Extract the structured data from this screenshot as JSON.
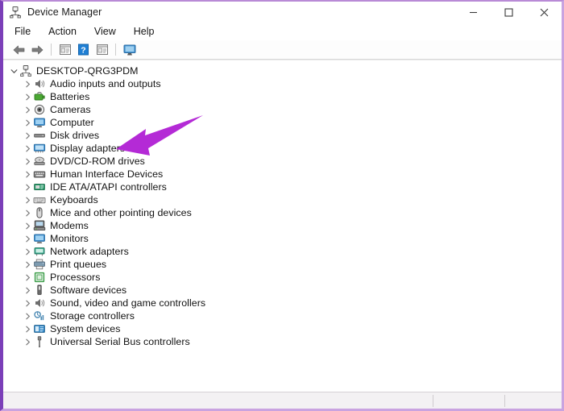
{
  "window": {
    "title": "Device Manager",
    "icon": "device-manager-icon",
    "border_color": "#7b3fb8",
    "controls": [
      {
        "name": "minimize-button",
        "glyph": "minimize"
      },
      {
        "name": "maximize-button",
        "glyph": "maximize"
      },
      {
        "name": "close-button",
        "glyph": "close"
      }
    ]
  },
  "menubar": {
    "items": [
      {
        "label": "File"
      },
      {
        "label": "Action"
      },
      {
        "label": "View"
      },
      {
        "label": "Help"
      }
    ]
  },
  "toolbar": {
    "buttons": [
      {
        "name": "back-button",
        "icon": "back-arrow-icon"
      },
      {
        "name": "forward-button",
        "icon": "forward-arrow-icon"
      },
      {
        "name": "properties-button",
        "icon": "properties-icon"
      },
      {
        "name": "help-button",
        "icon": "help-question-icon"
      },
      {
        "name": "update-driver-button",
        "icon": "update-driver-icon"
      },
      {
        "name": "scan-hardware-button",
        "icon": "scan-monitor-icon"
      }
    ]
  },
  "tree": {
    "root": {
      "label": "DESKTOP-QRG3PDM",
      "expanded": true,
      "icon": "computer-network-icon"
    },
    "items": [
      {
        "label": "Audio inputs and outputs",
        "icon": "speaker-icon"
      },
      {
        "label": "Batteries",
        "icon": "battery-icon"
      },
      {
        "label": "Cameras",
        "icon": "camera-icon"
      },
      {
        "label": "Computer",
        "icon": "monitor-icon"
      },
      {
        "label": "Disk drives",
        "icon": "disk-drive-icon"
      },
      {
        "label": "Display adapters",
        "icon": "display-adapter-icon"
      },
      {
        "label": "DVD/CD-ROM drives",
        "icon": "optical-drive-icon"
      },
      {
        "label": "Human Interface Devices",
        "icon": "hid-icon"
      },
      {
        "label": "IDE ATA/ATAPI controllers",
        "icon": "ide-controller-icon"
      },
      {
        "label": "Keyboards",
        "icon": "keyboard-icon"
      },
      {
        "label": "Mice and other pointing devices",
        "icon": "mouse-icon"
      },
      {
        "label": "Modems",
        "icon": "modem-icon"
      },
      {
        "label": "Monitors",
        "icon": "monitor-icon"
      },
      {
        "label": "Network adapters",
        "icon": "network-adapter-icon"
      },
      {
        "label": "Print queues",
        "icon": "printer-icon"
      },
      {
        "label": "Processors",
        "icon": "processor-icon"
      },
      {
        "label": "Software devices",
        "icon": "software-device-icon"
      },
      {
        "label": "Sound, video and game controllers",
        "icon": "sound-icon"
      },
      {
        "label": "Storage controllers",
        "icon": "storage-controller-icon"
      },
      {
        "label": "System devices",
        "icon": "system-device-icon"
      },
      {
        "label": "Universal Serial Bus controllers",
        "icon": "usb-icon"
      }
    ]
  },
  "annotation": {
    "name": "highlight-arrow",
    "color": "#b42ad6",
    "points_at": "Display adapters"
  },
  "statusbar": {
    "text": ""
  }
}
